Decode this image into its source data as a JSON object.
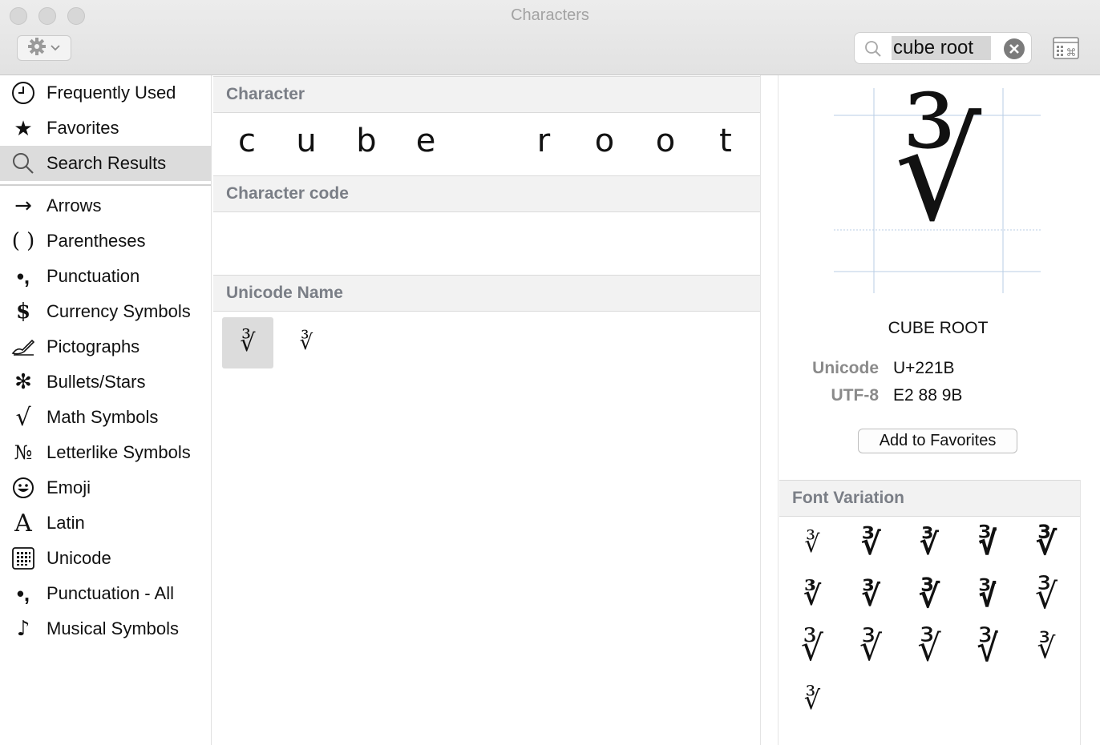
{
  "window": {
    "title": "Characters"
  },
  "search": {
    "value": "cube root"
  },
  "sidebar": {
    "items": [
      {
        "label": "Frequently Used",
        "icon": "clock-icon"
      },
      {
        "label": "Favorites",
        "icon": "star-icon"
      },
      {
        "label": "Search Results",
        "icon": "magnifier-icon",
        "selected": true
      }
    ],
    "categories": [
      {
        "label": "Arrows",
        "icon": "arrow-icon"
      },
      {
        "label": "Parentheses",
        "icon": "parentheses-icon"
      },
      {
        "label": "Punctuation",
        "icon": "punctuation-icon"
      },
      {
        "label": "Currency Symbols",
        "icon": "dollar-icon"
      },
      {
        "label": "Pictographs",
        "icon": "writing-hand-icon"
      },
      {
        "label": "Bullets/Stars",
        "icon": "asterisk-icon"
      },
      {
        "label": "Math Symbols",
        "icon": "square-root-icon"
      },
      {
        "label": "Letterlike Symbols",
        "icon": "numero-icon"
      },
      {
        "label": "Emoji",
        "icon": "smiley-icon"
      },
      {
        "label": "Latin",
        "icon": "latin-a-icon"
      },
      {
        "label": "Unicode",
        "icon": "unicode-grid-icon"
      },
      {
        "label": "Punctuation - All",
        "icon": "punctuation-icon"
      },
      {
        "label": "Musical Symbols",
        "icon": "music-note-icon"
      }
    ]
  },
  "middle": {
    "character_header": "Character",
    "characters": [
      "c",
      "u",
      "b",
      "e",
      "r",
      "o",
      "o",
      "t"
    ],
    "character_code_header": "Character code",
    "unicode_name_header": "Unicode Name",
    "results": [
      "∛",
      "∛"
    ]
  },
  "inspector": {
    "glyph": "∛",
    "name": "CUBE ROOT",
    "unicode_label": "Unicode",
    "unicode_value": "U+221B",
    "utf8_label": "UTF-8",
    "utf8_value": "E2 88 9B",
    "favorites_button": "Add to Favorites",
    "font_variation_header": "Font Variation",
    "variation_count": 16
  },
  "colors": {
    "selection": "#dcdcdc",
    "header_text": "#7a7e86",
    "guide_lines": "#b9cde6"
  }
}
